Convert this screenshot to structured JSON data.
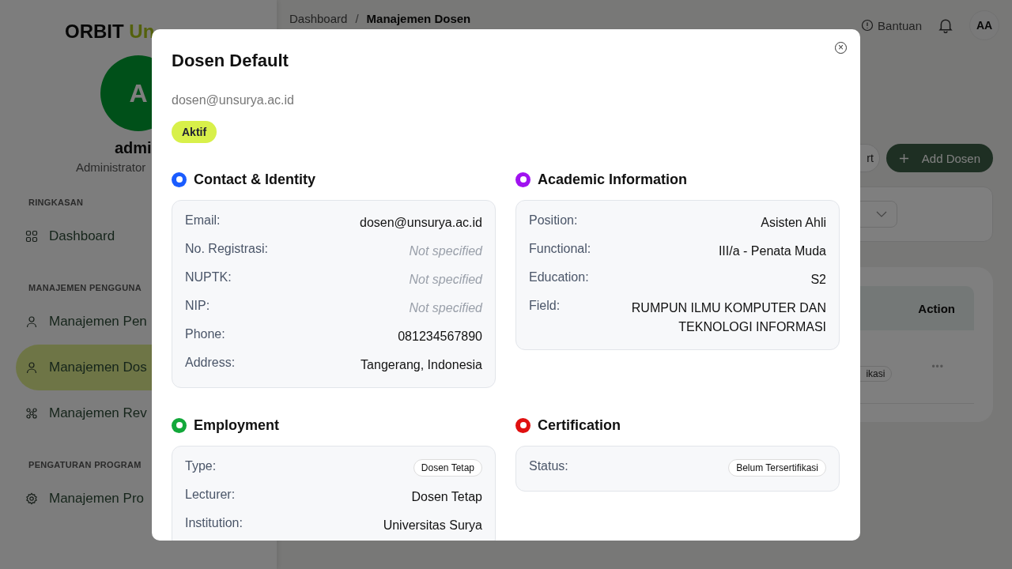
{
  "brand": {
    "name": "ORBIT",
    "accent": "Un"
  },
  "user": {
    "initial": "A",
    "name": "admi",
    "role": "Administrator"
  },
  "sidebar": {
    "sections": [
      {
        "title": "RINGKASAN",
        "items": [
          {
            "label": "Dashboard",
            "kind": "grid",
            "selected": false
          }
        ]
      },
      {
        "title": "MANAJEMEN PENGGUNA",
        "items": [
          {
            "label": "Manajemen Pen",
            "kind": "user",
            "selected": false
          },
          {
            "label": "Manajemen Dos",
            "kind": "user",
            "selected": true
          },
          {
            "label": "Manajemen Rev",
            "kind": "group",
            "selected": false
          }
        ]
      },
      {
        "title": "PENGATURAN PROGRAM",
        "items": [
          {
            "label": "Manajemen Pro",
            "kind": "gear",
            "selected": false
          }
        ]
      }
    ]
  },
  "topbar": {
    "breadcrumb": [
      "Dashboard",
      "Manajemen Dosen"
    ],
    "separator": "/",
    "help": "Bantuan",
    "avatar": "AA"
  },
  "toolbar": {
    "export": "rt",
    "add": "Add Dosen"
  },
  "table": {
    "columns": [
      "Action"
    ],
    "rows": [
      {
        "badge": "ikasi",
        "action": "•••"
      }
    ]
  },
  "modal": {
    "title": "Dosen Default",
    "email": "dosen@unsurya.ac.id",
    "status": "Aktif",
    "close": "×",
    "sections": [
      {
        "title": "Contact & Identity",
        "color": "#1a5cff",
        "rows": [
          {
            "label": "Email:",
            "value": "dosen@unsurya.ac.id",
            "kind": "text"
          },
          {
            "label": "No. Registrasi:",
            "value": "Not specified",
            "kind": "empty"
          },
          {
            "label": "NUPTK:",
            "value": "Not specified",
            "kind": "empty"
          },
          {
            "label": "NIP:",
            "value": "Not specified",
            "kind": "empty"
          },
          {
            "label": "Phone:",
            "value": "081234567890",
            "kind": "text"
          },
          {
            "label": "Address:",
            "value": "Tangerang, Indonesia",
            "kind": "text"
          }
        ]
      },
      {
        "title": "Academic Information",
        "color": "#a012f0",
        "rows": [
          {
            "label": "Position:",
            "value": "Asisten Ahli",
            "kind": "text"
          },
          {
            "label": "Functional:",
            "value": "III/a - Penata Muda",
            "kind": "text"
          },
          {
            "label": "Education:",
            "value": "S2",
            "kind": "text"
          },
          {
            "label": "Field:",
            "value": "RUMPUN ILMU KOMPUTER DAN TEKNOLOGI INFORMASI",
            "kind": "text"
          }
        ]
      },
      {
        "title": "Employment",
        "color": "#12a83a",
        "rows": [
          {
            "label": "Type:",
            "value": "Dosen Tetap",
            "kind": "tag"
          },
          {
            "label": "Lecturer:",
            "value": "Dosen Tetap",
            "kind": "text"
          },
          {
            "label": "Institution:",
            "value": "Universitas Surya",
            "kind": "text"
          }
        ]
      },
      {
        "title": "Certification",
        "color": "#e01010",
        "rows": [
          {
            "label": "Status:",
            "value": "Belum Tersertifikasi",
            "kind": "tag"
          }
        ]
      }
    ]
  }
}
